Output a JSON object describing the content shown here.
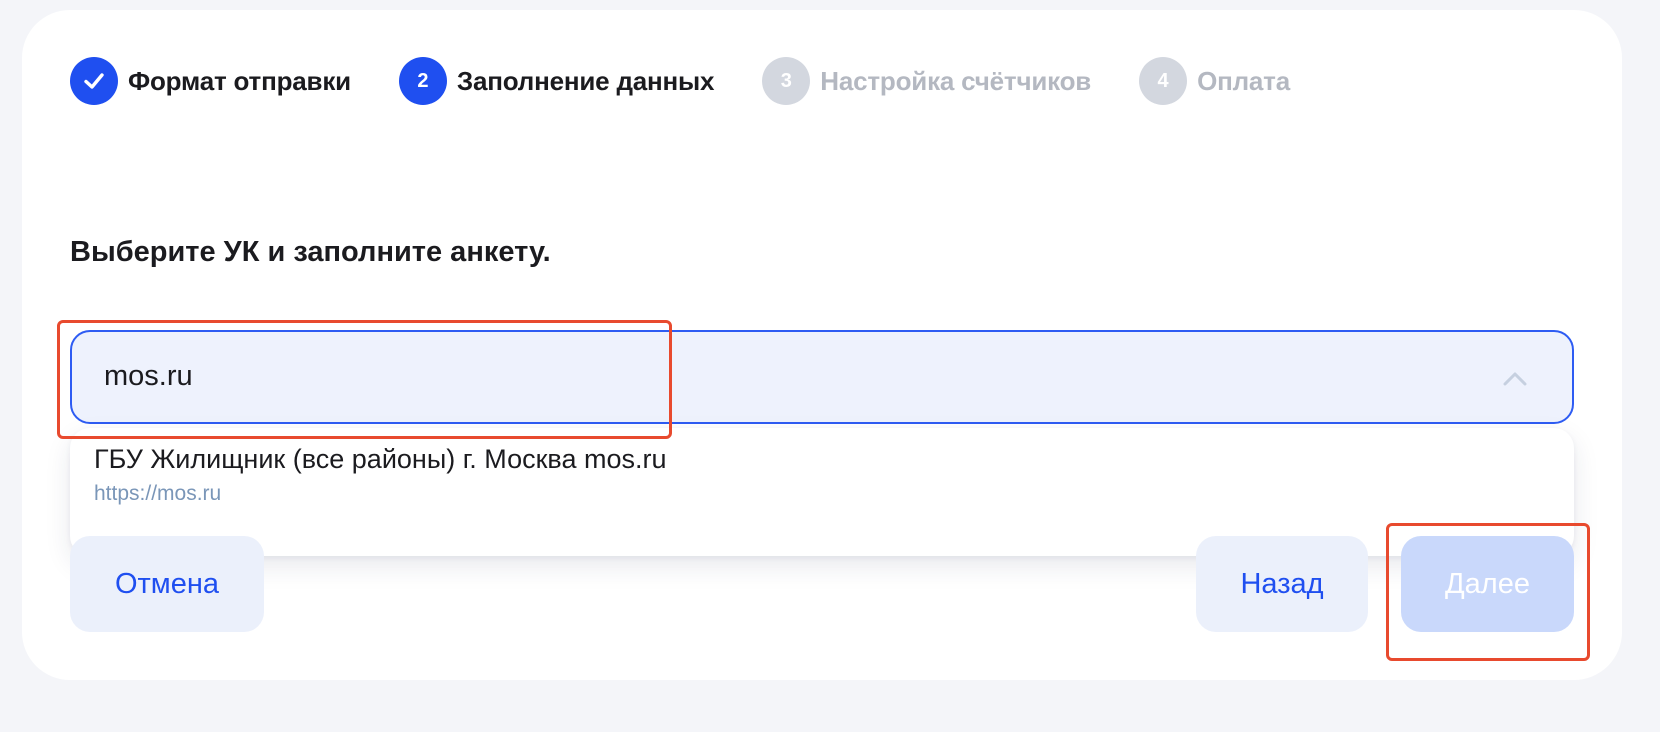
{
  "steps": [
    {
      "number": "",
      "label": "Формат отправки",
      "state": "done",
      "icon": "check-icon"
    },
    {
      "number": "2",
      "label": "Заполнение данных",
      "state": "active"
    },
    {
      "number": "3",
      "label": "Настройка счётчиков",
      "state": "inactive"
    },
    {
      "number": "4",
      "label": "Оплата",
      "state": "inactive"
    }
  ],
  "form": {
    "heading": "Выберите УК и заполните анкету.",
    "select_value": "mos.ru"
  },
  "dropdown": {
    "options": [
      {
        "title": "ГБУ Жилищник (все районы) г. Москва mos.ru",
        "url": "https://mos.ru"
      }
    ]
  },
  "buttons": {
    "cancel": "Отмена",
    "back": "Назад",
    "next": "Далее"
  },
  "colors": {
    "accent": "#1f4ff0",
    "inactive_step": "#d3d7df",
    "highlight": "#e84a2e"
  }
}
